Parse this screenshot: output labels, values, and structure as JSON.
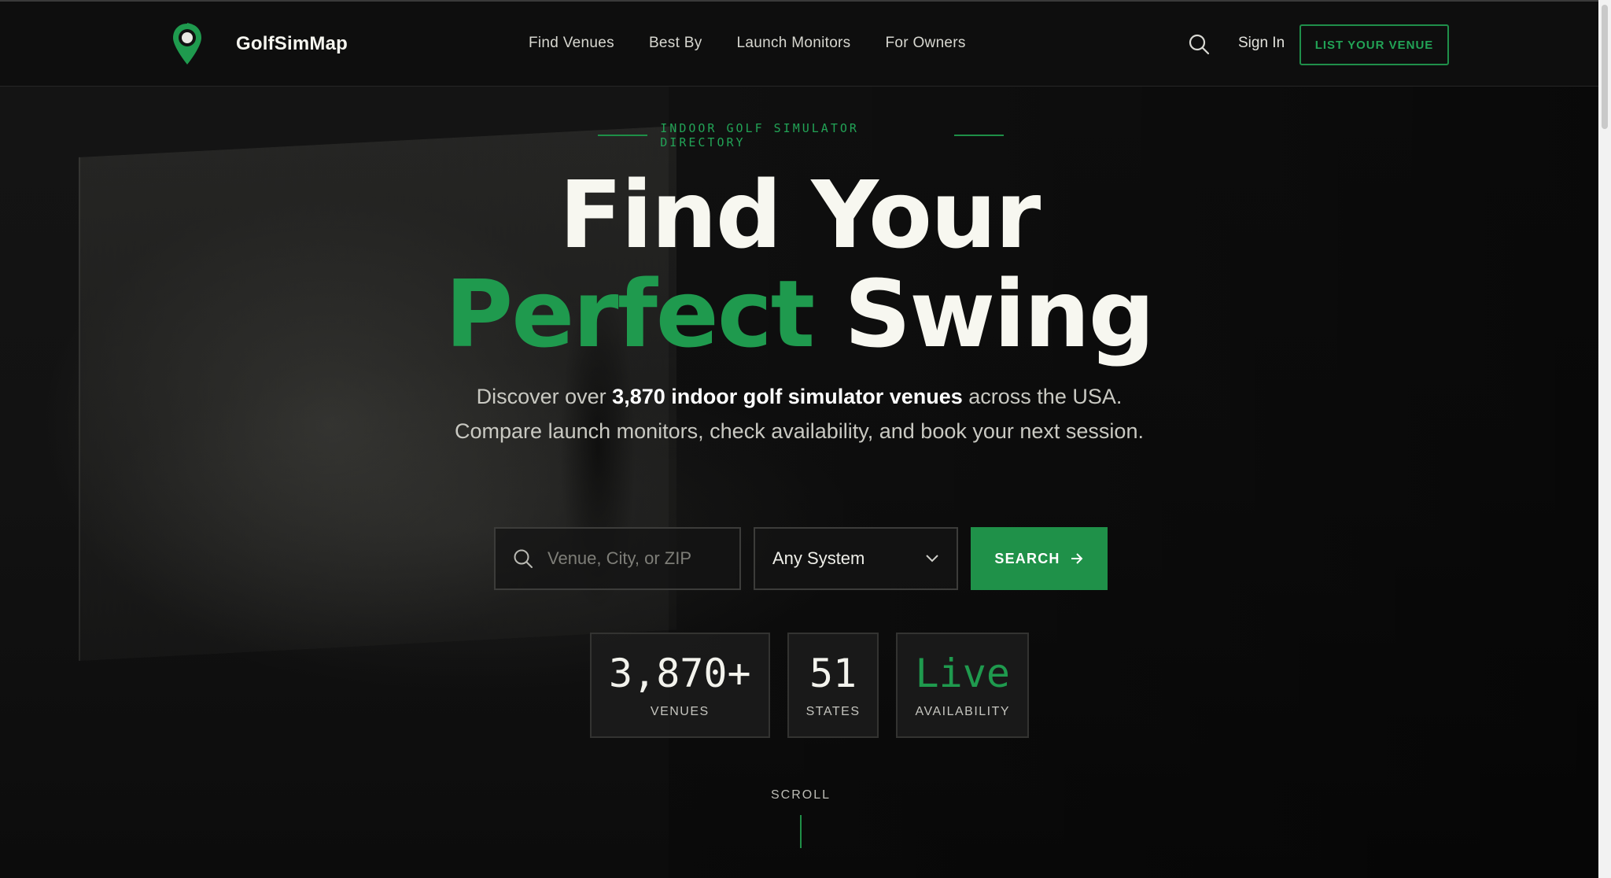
{
  "nav": {
    "brand": "GolfSimMap",
    "links": [
      "Find Venues",
      "Best By",
      "Launch Monitors",
      "For Owners"
    ],
    "sign_in": "Sign In",
    "cta": "LIST YOUR VENUE"
  },
  "hero": {
    "eyebrow": "INDOOR GOLF SIMULATOR DIRECTORY",
    "headline_line1": "Find Your",
    "headline_green": "Perfect",
    "headline_white": "Swing",
    "sub_prefix": "Discover over ",
    "sub_bold": "3,870 indoor golf simulator venues",
    "sub_suffix": " across the USA. Compare launch monitors, check availability, and book your next session."
  },
  "search": {
    "placeholder": "Venue, City, or ZIP",
    "system_selected": "Any System",
    "button": "SEARCH"
  },
  "stats": [
    {
      "value": "3,870+",
      "label": "VENUES"
    },
    {
      "value": "51",
      "label": "STATES"
    },
    {
      "value": "Live",
      "label": "AVAILABILITY"
    }
  ],
  "scroll_label": "SCROLL",
  "colors": {
    "accent": "#1f9a4e",
    "background": "#0d0d0d"
  }
}
